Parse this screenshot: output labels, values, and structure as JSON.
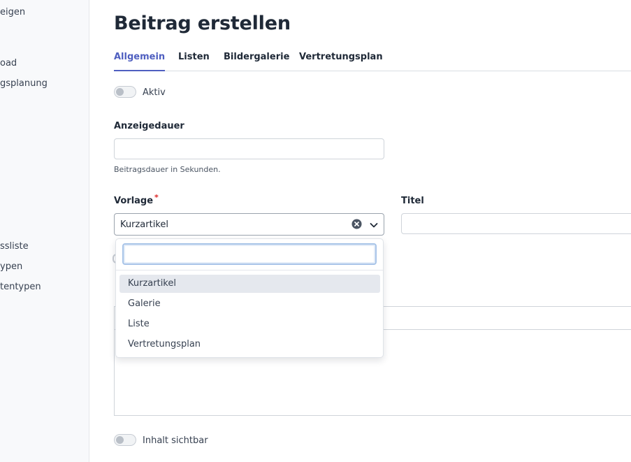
{
  "sidebar": {
    "items": [
      {
        "label": "eigen"
      },
      {
        "label": "oad"
      },
      {
        "label": "gsplanung"
      },
      {
        "label": "ssliste"
      },
      {
        "label": "ypen"
      },
      {
        "label": "tentypen"
      }
    ]
  },
  "page": {
    "title": "Beitrag erstellen"
  },
  "tabs": [
    {
      "label": "Allgemein",
      "active": true
    },
    {
      "label": "Listen",
      "active": false
    },
    {
      "label": "Bildergalerie",
      "active": false
    },
    {
      "label": "Vertretungsplan",
      "active": false
    }
  ],
  "form": {
    "aktiv": {
      "label": "Aktiv",
      "checked": false
    },
    "anzeigedauer": {
      "label": "Anzeigedauer",
      "value": "",
      "helper": "Beitragsdauer in Sekunden."
    },
    "vorlage": {
      "label": "Vorlage",
      "required_mark": "*",
      "value": "Kurzartikel",
      "search_value": "",
      "options": [
        "Kurzartikel",
        "Galerie",
        "Liste",
        "Vertretungsplan"
      ],
      "highlighted_option": "Kurzartikel"
    },
    "titel": {
      "label": "Titel",
      "value": ""
    },
    "inhalt_sichtbar": {
      "label": "Inhalt sichtbar",
      "checked": false
    }
  },
  "colors": {
    "accent": "#4f5fc0",
    "required": "#dc2626",
    "option_highlight": "#e5e8ee"
  },
  "icons": {
    "clear": "clear-circle-icon",
    "dropdown": "chevron-down-icon"
  }
}
